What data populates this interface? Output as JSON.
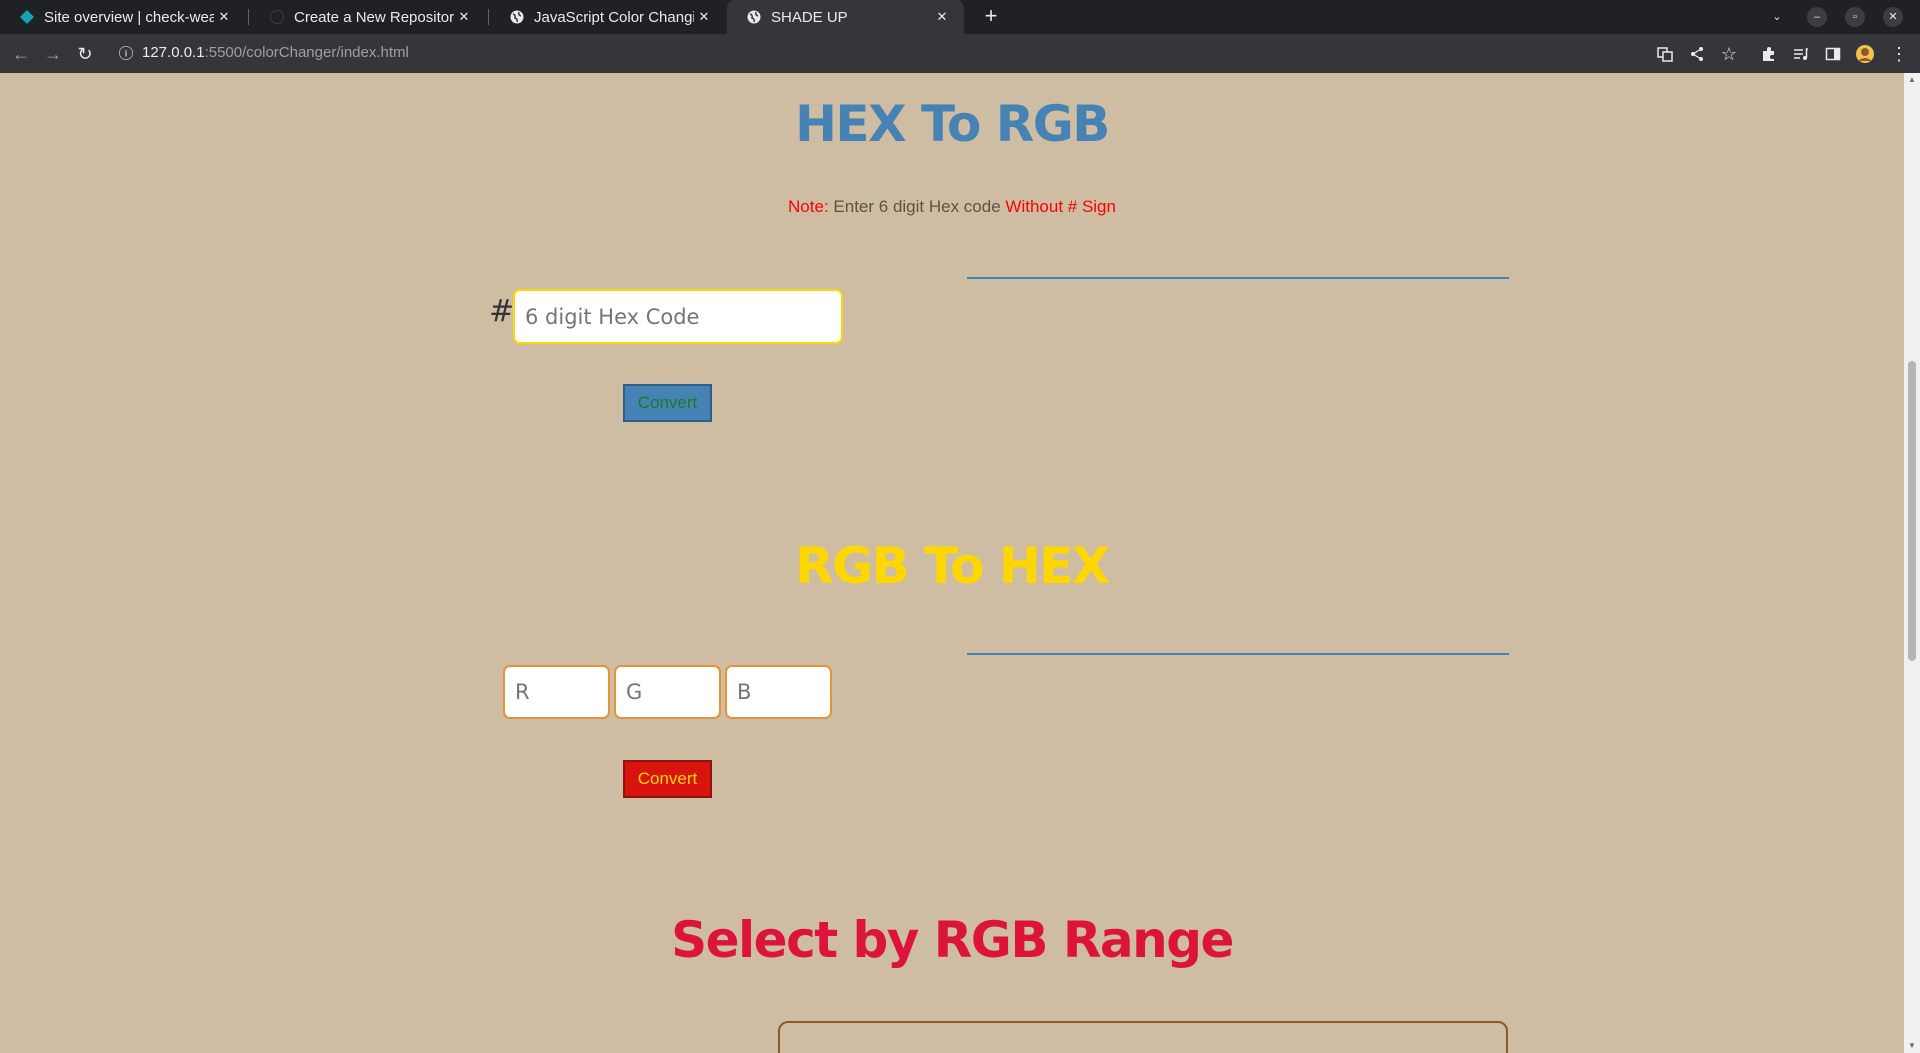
{
  "browser": {
    "tabs": [
      {
        "title": "Site overview | check-weat",
        "icon": "diamond-icon",
        "active": false
      },
      {
        "title": "Create a New Repository",
        "icon": "github-icon",
        "active": false
      },
      {
        "title": "JavaScript Color Changing",
        "icon": "globe-icon",
        "active": false
      },
      {
        "title": "SHADE UP",
        "icon": "globe-icon",
        "active": true
      }
    ],
    "url_host": "127.0.0.1",
    "url_path": ":5500/colorChanger/index.html"
  },
  "hex_section": {
    "title": "HEX To RGB",
    "note_label": "Note:",
    "note_text": "Enter 6 digit Hex code",
    "note_emphasis": "Without # Sign",
    "hash_symbol": "#",
    "input_placeholder": "6 digit Hex Code",
    "button_label": "Convert"
  },
  "rgb_section": {
    "title": "RGB To HEX",
    "r_placeholder": "R",
    "g_placeholder": "G",
    "b_placeholder": "B",
    "button_label": "Convert"
  },
  "range_section": {
    "title": "Select by RGB Range"
  },
  "colors": {
    "page_background": "#cebda2",
    "hex_title": "#4682b4",
    "rgb_title": "#ffd700",
    "range_title": "#dc143c",
    "note_red": "#ff0000"
  }
}
